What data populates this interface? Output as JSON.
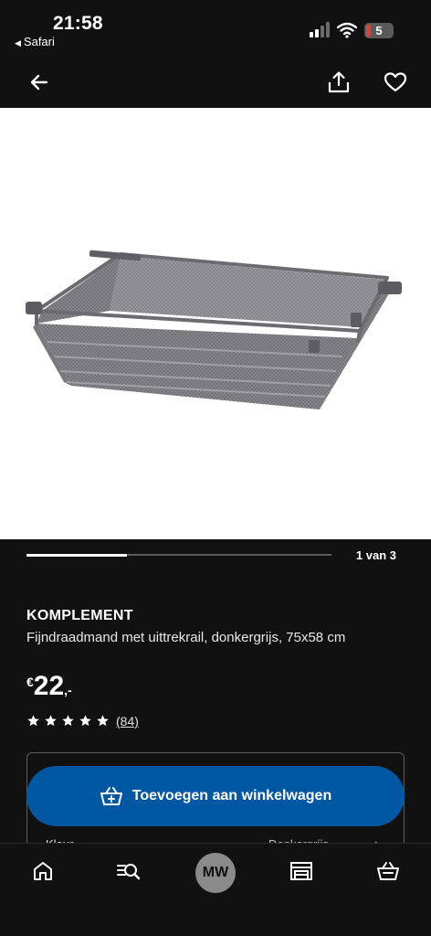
{
  "status_bar": {
    "time": "21:58",
    "back_app": "Safari",
    "battery_level": "5"
  },
  "header": {
    "back_icon": "arrow-left-icon",
    "share_icon": "share-icon",
    "favorite_icon": "heart-icon"
  },
  "gallery": {
    "counter": "1 van 3",
    "progress": 0.33
  },
  "product": {
    "brand": "KOMPLEMENT",
    "description": "Fijndraadmand met uittrekrail, donkergrijs, 75x58 cm",
    "price_currency": "€",
    "price_amount": "22",
    "price_decimals": ",-",
    "rating_stars": 5,
    "review_count": "(84)"
  },
  "options": {
    "color_label": "Kleur",
    "color_value": "Donkergrijs"
  },
  "cart": {
    "add_label": "Toevoegen aan winkelwagen",
    "accent": "#0058a3"
  },
  "bottom_nav": {
    "items": [
      "home-icon",
      "search-icon",
      "account-avatar",
      "store-icon",
      "cart-icon"
    ],
    "avatar_initials": "MW"
  }
}
